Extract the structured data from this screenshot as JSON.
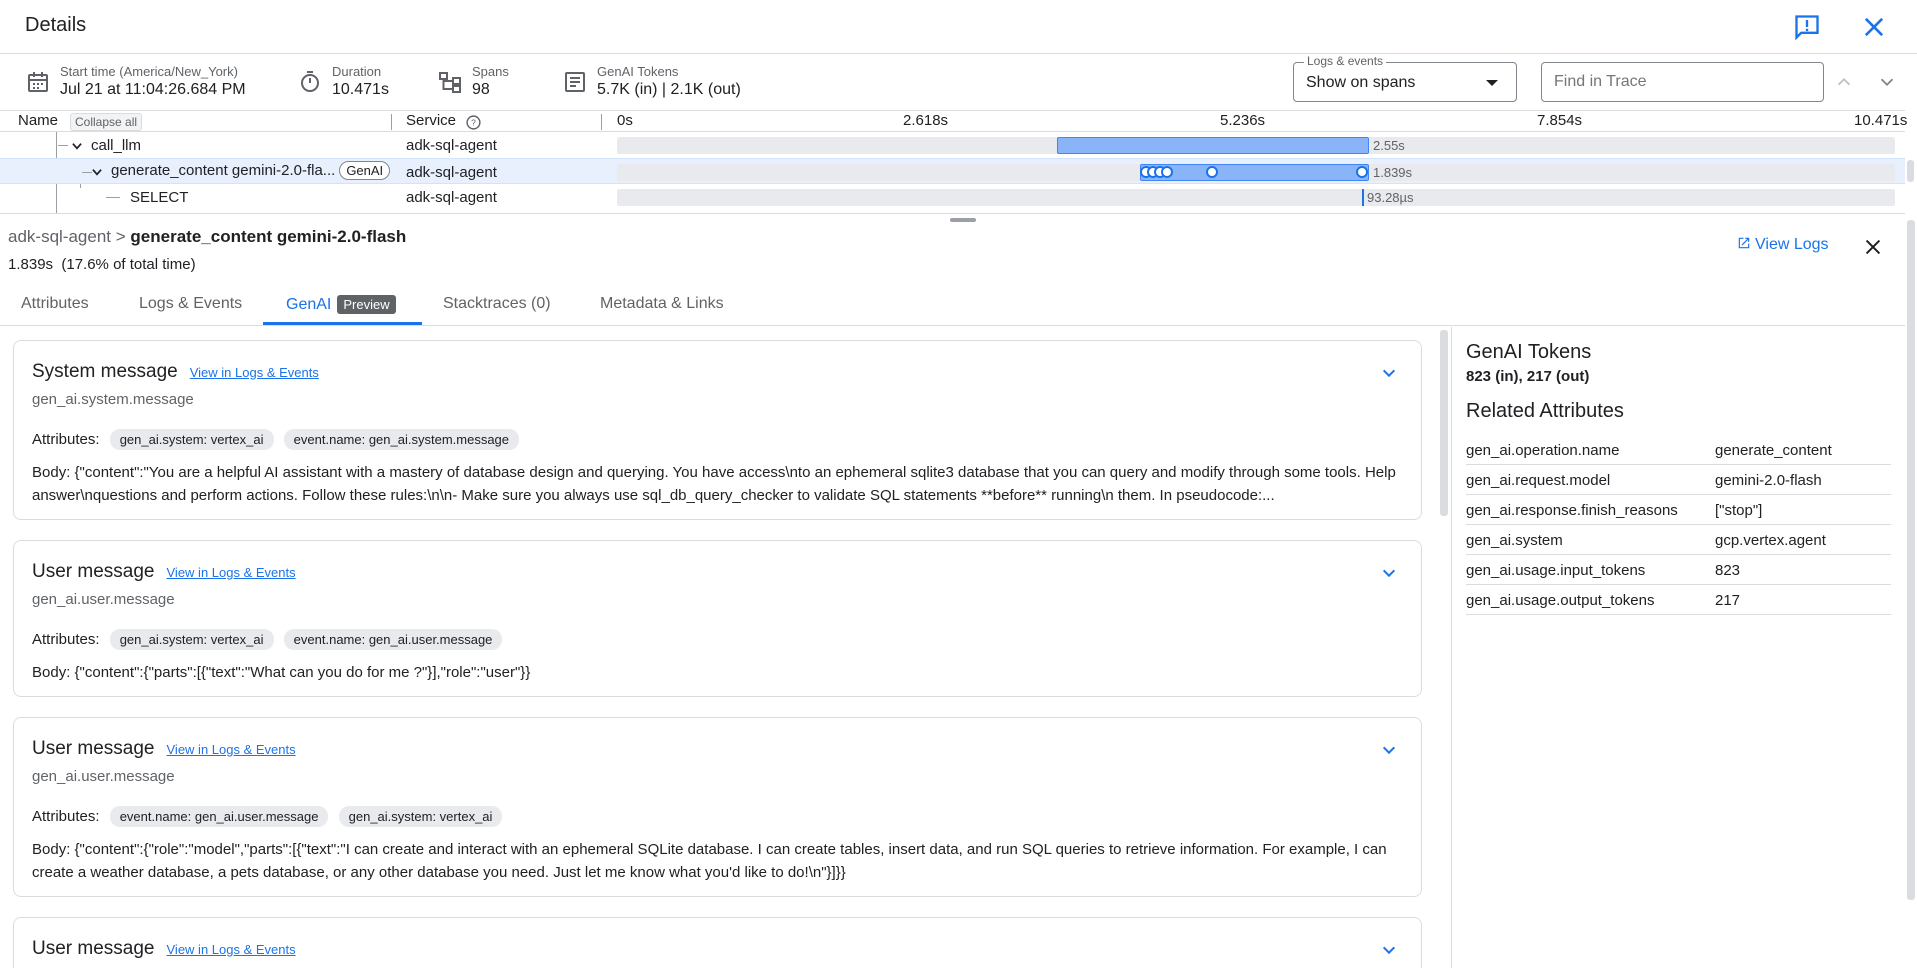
{
  "header": {
    "title": "Details"
  },
  "info": {
    "start_label": "Start time (America/New_York)",
    "start_value": "Jul 21 at 11:04:26.684 PM",
    "duration_label": "Duration",
    "duration_value": "10.471s",
    "spans_label": "Spans",
    "spans_value": "98",
    "tokens_label": "GenAI Tokens",
    "tokens_value": "5.7K (in) | 2.1K (out)",
    "logs_legend": "Logs & events",
    "logs_value": "Show on spans",
    "find_placeholder": "Find in Trace"
  },
  "table": {
    "name_header": "Name",
    "collapse_label": "Collapse all",
    "service_header": "Service",
    "ticks": [
      "0s",
      "2.618s",
      "5.236s",
      "7.854s",
      "10.471s"
    ],
    "rows": [
      {
        "name": "call_llm",
        "service": "adk-sql-agent",
        "duration": "2.55s"
      },
      {
        "name": "generate_content gemini-2.0-fla...",
        "chip": "GenAI",
        "service": "adk-sql-agent",
        "duration": "1.839s"
      },
      {
        "name": "SELECT",
        "service": "adk-sql-agent",
        "duration": "93.28µs"
      }
    ]
  },
  "detail": {
    "crumb_parent": "adk-sql-agent",
    "crumb_sep": ">",
    "crumb_current": "generate_content gemini-2.0-flash",
    "time": "1.839s  (17.6% of total time)",
    "view_logs": "View Logs",
    "tabs": [
      "Attributes",
      "Logs & Events",
      "GenAI",
      "Stacktraces (0)",
      "Metadata & Links"
    ],
    "preview_badge": "Preview"
  },
  "messages": [
    {
      "title": "System message",
      "link": "View in Logs & Events",
      "event": "gen_ai.system.message",
      "attrs_label": "Attributes:",
      "chips": [
        "gen_ai.system: vertex_ai",
        "event.name: gen_ai.system.message"
      ],
      "body_label": "Body:",
      "body": " {\"content\":\"You are a helpful AI assistant with a mastery of database design and querying. You have access\\nto an ephemeral sqlite3 database that you can query and modify through some tools. Help answer\\nquestions and perform actions. Follow these rules:\\n\\n- Make sure you always use sql_db_query_checker to validate SQL statements **before** running\\n them. In pseudocode:..."
    },
    {
      "title": "User message",
      "link": "View in Logs & Events",
      "event": "gen_ai.user.message",
      "attrs_label": "Attributes:",
      "chips": [
        "gen_ai.system: vertex_ai",
        "event.name: gen_ai.user.message"
      ],
      "body_label": "Body:",
      "body": " {\"content\":{\"parts\":[{\"text\":\"What can you do for me ?\"}],\"role\":\"user\"}}"
    },
    {
      "title": "User message",
      "link": "View in Logs & Events",
      "event": "gen_ai.user.message",
      "attrs_label": "Attributes:",
      "chips": [
        "event.name: gen_ai.user.message",
        "gen_ai.system: vertex_ai"
      ],
      "body_label": "Body:",
      "body": " {\"content\":{\"role\":\"model\",\"parts\":[{\"text\":\"I can create and interact with an ephemeral SQLite database. I can create tables, insert data, and run SQL queries to retrieve information. For example, I can create a weather database, a pets database, or any other database you need. Just let me know what you'd like to do!\\n\"}]}}"
    },
    {
      "title": "User message",
      "link": "View in Logs & Events"
    }
  ],
  "right": {
    "tokens_title": "GenAI Tokens",
    "tokens_value": "823 (in), 217 (out)",
    "related_title": "Related Attributes",
    "attrs": [
      {
        "k": "gen_ai.operation.name",
        "v": "generate_content"
      },
      {
        "k": "gen_ai.request.model",
        "v": "gemini-2.0-flash"
      },
      {
        "k": "gen_ai.response.finish_reasons",
        "v": "[\"stop\"]"
      },
      {
        "k": "gen_ai.system",
        "v": "gcp.vertex.agent"
      },
      {
        "k": "gen_ai.usage.input_tokens",
        "v": "823"
      },
      {
        "k": "gen_ai.usage.output_tokens",
        "v": "217"
      }
    ]
  },
  "colors": {
    "accent": "#1a73e8",
    "bar": "#8ab4f8"
  }
}
